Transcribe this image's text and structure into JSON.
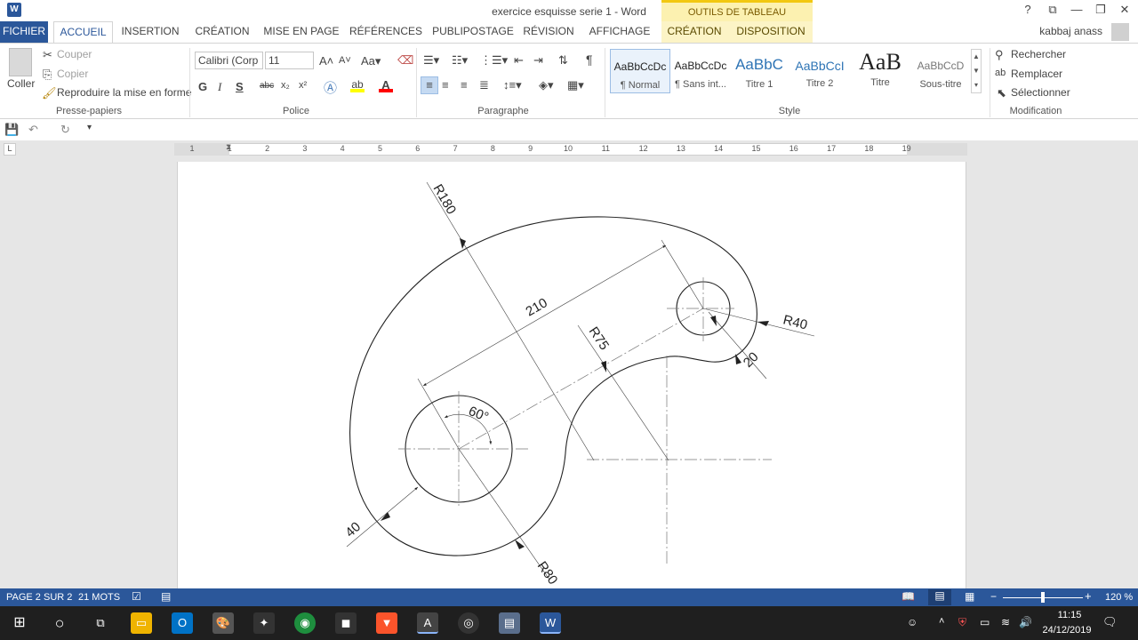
{
  "window": {
    "title": "exercice esquisse serie 1 - Word",
    "context_title": "OUTILS DE TABLEAU",
    "user": "kabbaj anass",
    "help": "?",
    "min": "—",
    "max": "❐",
    "close": "✕",
    "opts": "⧉",
    "word": "W"
  },
  "tabs": [
    "FICHIER",
    "ACCUEIL",
    "INSERTION",
    "CRÉATION",
    "MISE EN PAGE",
    "RÉFÉRENCES",
    "PUBLIPOSTAGE",
    "RÉVISION",
    "AFFICHAGE"
  ],
  "context_tabs": [
    "CRÉATION",
    "DISPOSITION"
  ],
  "clipboard": {
    "paste": "Coller",
    "cut": "Couper",
    "copy": "Copier",
    "format": "Reproduire la mise en forme",
    "label": "Presse-papiers"
  },
  "font": {
    "name": "Calibri (Corp",
    "size": "11",
    "label": "Police",
    "bold": "G",
    "italic": "I",
    "underline": "S",
    "strike": "abc",
    "sub": "x₂",
    "sup": "x²"
  },
  "paragraph": {
    "label": "Paragraphe"
  },
  "styles": {
    "label": "Style",
    "items": [
      {
        "sample": "AaBbCcDc",
        "name": "¶ Normal"
      },
      {
        "sample": "AaBbCcDc",
        "name": "¶ Sans int..."
      },
      {
        "sample": "AaBbC",
        "name": "Titre 1"
      },
      {
        "sample": "AaBbCcI",
        "name": "Titre 2"
      },
      {
        "sample": "AaB",
        "name": "Titre"
      },
      {
        "sample": "AaBbCcD",
        "name": "Sous-titre"
      }
    ]
  },
  "editing": {
    "find": "Rechercher",
    "replace": "Remplacer",
    "select": "Sélectionner",
    "label": "Modification"
  },
  "ruler": [
    "1",
    "1",
    "2",
    "3",
    "4",
    "5",
    "6",
    "7",
    "8",
    "9",
    "10",
    "11",
    "12",
    "13",
    "14",
    "15",
    "16",
    "17",
    "18",
    "19"
  ],
  "drawing_labels": {
    "r180": "R180",
    "dim210": "210",
    "r40": "R40",
    "r75": "R75",
    "dim20": "20",
    "angle": "60°",
    "dim40": "40",
    "r80": "R80"
  },
  "status": {
    "page": "PAGE 2 SUR 2",
    "words": "21 MOTS",
    "zoom": "120 %"
  },
  "taskbar": {
    "time": "11:15",
    "date": "24/12/2019"
  },
  "colors": {
    "word_blue": "#2b579a",
    "context_yellow": "#fcf1b0",
    "accent_gold": "#f2c811"
  }
}
